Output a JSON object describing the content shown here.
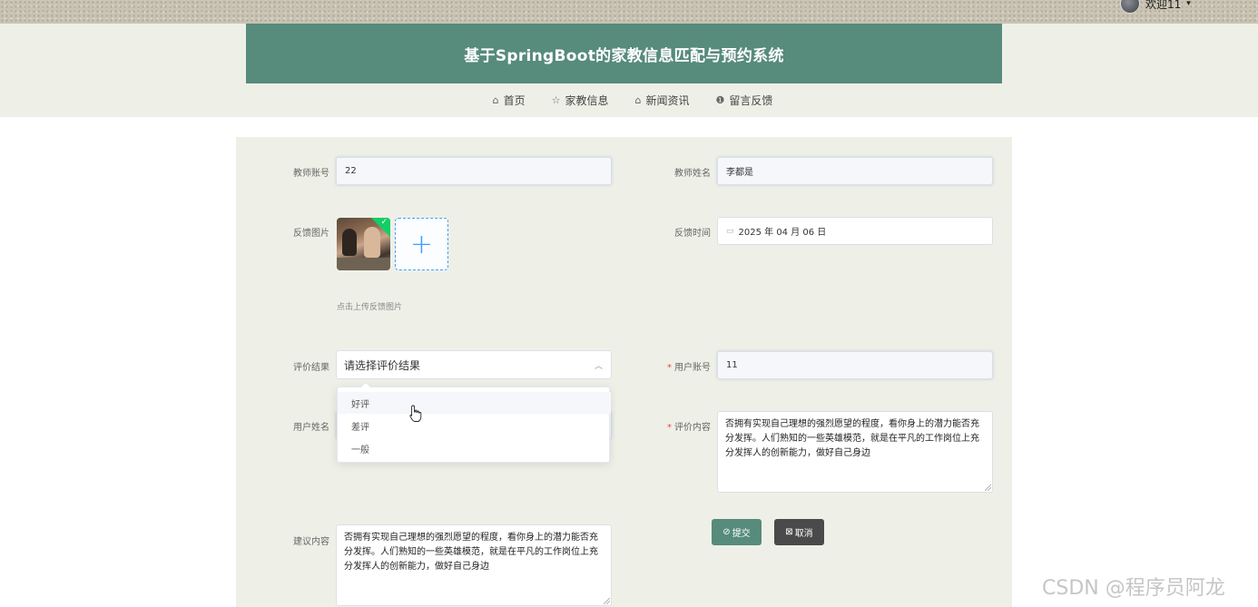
{
  "topbar": {
    "welcome": "欢迎11",
    "caret": "▾"
  },
  "header": {
    "title": "基于SpringBoot的家教信息匹配与预约系统"
  },
  "nav": [
    {
      "icon": "⌂",
      "icon_name": "home-icon",
      "label": "首页"
    },
    {
      "icon": "☆",
      "icon_name": "star-icon",
      "label": "家教信息"
    },
    {
      "icon": "⌂",
      "icon_name": "bag-icon",
      "label": "新闻资讯"
    },
    {
      "icon": "❶",
      "icon_name": "info-icon",
      "label": "留言反馈"
    }
  ],
  "form": {
    "teacher_account": {
      "label": "教师账号",
      "value": "22"
    },
    "teacher_name": {
      "label": "教师姓名",
      "value": "李都是"
    },
    "feedback_image": {
      "label": "反馈图片",
      "hint": "点击上传反馈图片",
      "add": "+"
    },
    "feedback_time": {
      "label": "反馈时间",
      "value": "2025 年 04 月 06 日"
    },
    "rating": {
      "label": "评价结果",
      "placeholder": "请选择评价结果",
      "options": [
        "好评",
        "差评",
        "一般"
      ]
    },
    "user_account": {
      "label": "用户账号",
      "required": "*",
      "value": "11"
    },
    "user_name": {
      "label": "用户姓名"
    },
    "review_content": {
      "label": "评价内容",
      "required": "*",
      "value": "否拥有实现自己理想的强烈愿望的程度，看你身上的潜力能否充分发挥。人们熟知的一些英雄模范，就是在平凡的工作岗位上充分发挥人的创新能力，做好自己身边"
    },
    "suggestion": {
      "label": "建议内容",
      "value": "否拥有实现自己理想的强烈愿望的程度，看你身上的潜力能否充分发挥。人们熟知的一些英雄模范，就是在平凡的工作岗位上充分发挥人的创新能力，做好自己身边"
    },
    "submit": {
      "icon": "⊘",
      "label": "提交"
    },
    "cancel": {
      "icon": "⊠",
      "label": "取消"
    }
  },
  "watermark": "CSDN @程序员阿龙",
  "colors": {
    "primary": "#578b7c",
    "panel": "#eef0e7",
    "cancel": "#4a4a4a",
    "upload_accent": "#409eff"
  }
}
